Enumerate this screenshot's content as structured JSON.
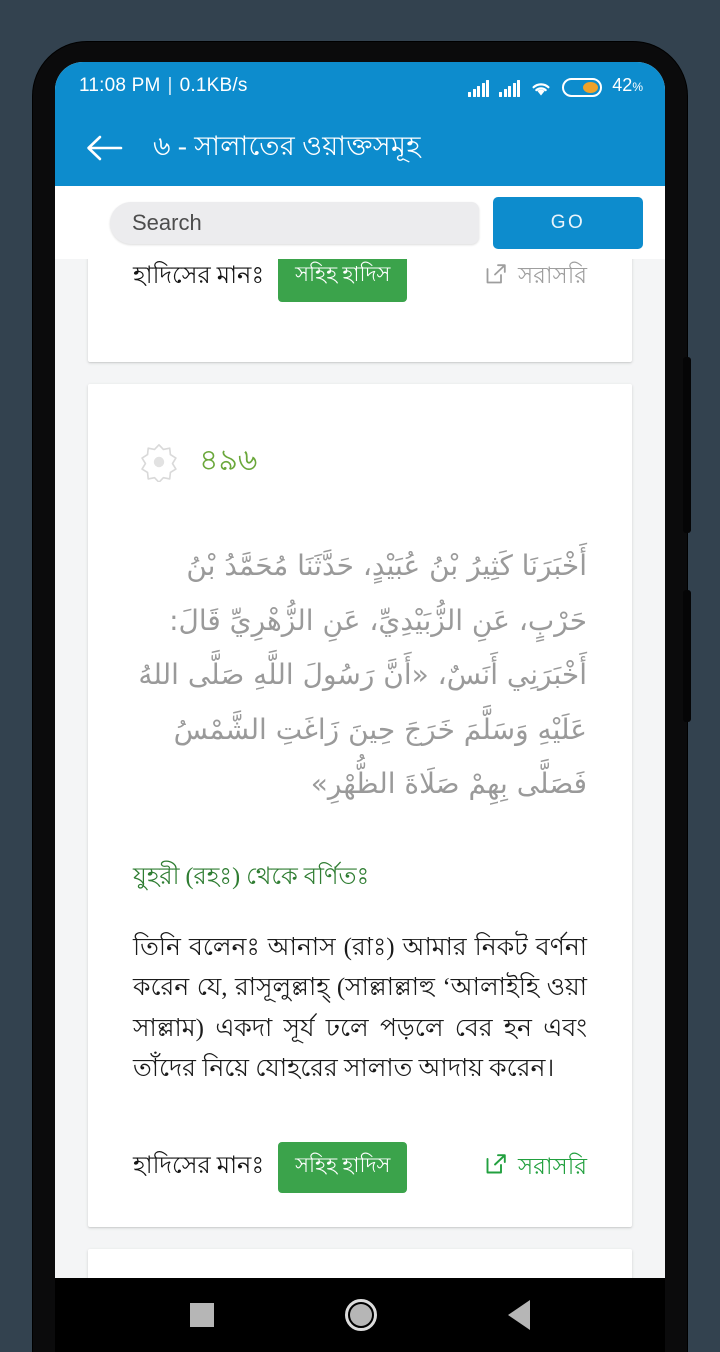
{
  "status_bar": {
    "time": "11:08 PM",
    "separator": "|",
    "network_speed": "0.1KB/s",
    "battery_percent": "42",
    "battery_percent_symbol": "%",
    "icons": [
      "signal-bars-icon",
      "signal-bars-icon",
      "wifi-icon",
      "battery-icon"
    ]
  },
  "app_bar": {
    "back_icon": "back-arrow-icon",
    "title": "৬  - সালাতের ওয়াক্তসমূহ",
    "background_color": "#0d8ccd"
  },
  "search": {
    "value": "",
    "placeholder": "Search",
    "go_label": "GO"
  },
  "cards": [
    {
      "id": "card-partial-top",
      "grade_label": "হাদিসের মানঃ",
      "grade_badge": "সহিহ হাদিস",
      "direct_link": "সরাসরি",
      "direct_link_color": "#9e9e9e"
    },
    {
      "id": "card-main",
      "hadith_number": "৪৯৬",
      "star_icon": "islamic-star-icon",
      "arabic": "أَخْبَرَنَا كَثِيرُ بْنُ عُبَيْدٍ، حَدَّثَنَا مُحَمَّدُ بْنُ حَرْبٍ، عَنِ الزُّبَيْدِيِّ، عَنِ الزُّهْرِيِّ قَالَ: أَخْبَرَنِي أَنَسٌ، «أَنَّ رَسُولَ اللَّهِ صَلَّى اللهُ عَلَيْهِ وَسَلَّمَ خَرَجَ حِينَ زَاغَتِ الشَّمْسُ فَصَلَّى بِهِمْ صَلَاةَ الظُّهْرِ»",
      "narrator": "যুহরী (রহঃ) থেকে বর্ণিতঃ",
      "body": "তিনি বলেনঃ আনাস (রাঃ) আমার নিকট বর্ণনা করেন যে, রাসূলুল্লাহ্ (সাল্লাল্লাহু ‘আলাইহি ওয়া সাল্লাম) একদা সূর্য ঢলে পড়লে বের হন এবং তাঁদের নিয়ে যোহরের সালাত আদায় করেন।",
      "grade_label": "হাদিসের মানঃ",
      "grade_badge": "সহিহ হাদিস",
      "direct_link": "সরাসরি",
      "direct_link_color": "#22a03f"
    }
  ],
  "nav_bar": {
    "recent_icon": "square-recents-icon",
    "home_icon": "circle-home-icon",
    "back_icon": "triangle-back-icon"
  },
  "colors": {
    "accent_blue": "#0d8ccd",
    "badge_green": "#3ba34b",
    "number_green": "#6aa73a",
    "narrator_green": "#2f7d32",
    "page_bg": "#f4f5f6",
    "desk_bg": "#33424f"
  }
}
